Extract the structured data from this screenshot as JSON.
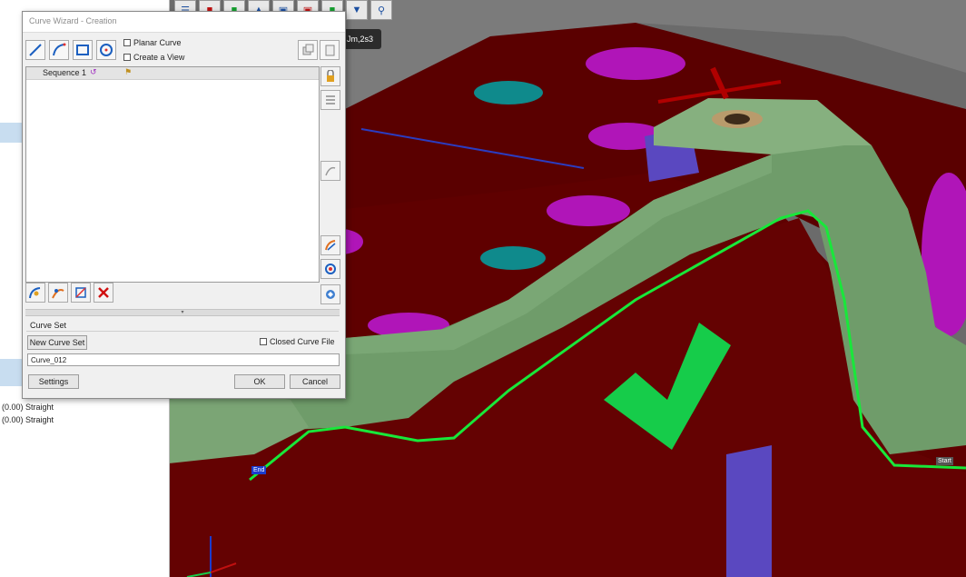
{
  "dialog": {
    "title": "Curve Wizard - Creation",
    "planar_curve_label": "Planar Curve",
    "create_view_label": "Create a View",
    "sequence_label": "Sequence 1",
    "curve_set_title": "Curve Set",
    "new_curve_set_label": "New Curve Set",
    "closed_curve_file_label": "Closed Curve File",
    "curve_name_value": "Curve_012",
    "settings_label": "Settings",
    "ok_label": "OK",
    "cancel_label": "Cancel"
  },
  "tree": {
    "lines": [
      "(0.00) Straight",
      "(0.00) Straight"
    ]
  },
  "viewport": {
    "point_tooltip": "Jm,2s3",
    "end_tag": "End",
    "start_tag": "Start",
    "accent_green": "#16cc4a",
    "body_red": "#5e0000",
    "wall_green": "#6f9c6a",
    "hole_magenta": "#b015b8",
    "hole_teal": "#0f8a8c"
  },
  "icons": {
    "toolbar": [
      "line-icon",
      "arc-icon",
      "rectangle-icon",
      "circle-icon"
    ],
    "right_strip": [
      "lock-icon",
      "list-icon",
      "curve-edit-icon",
      "trim-icon",
      "offset-icon",
      "project-icon"
    ],
    "bottom": [
      "arc-tool-icon",
      "spline-icon",
      "move-icon",
      "delete-icon"
    ]
  }
}
